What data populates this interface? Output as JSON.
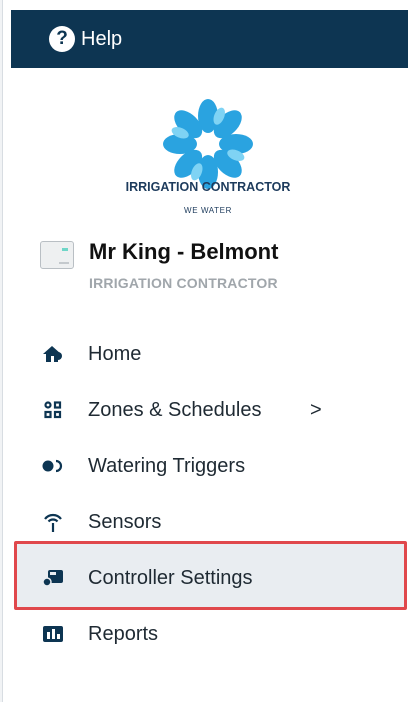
{
  "header": {
    "help_label": "Help",
    "help_icon": "question-circle-icon"
  },
  "logo": {
    "brand": "IRRIGATION CONTRACTOR",
    "tagline": "WE WATER",
    "colors": [
      "#2aa3e0",
      "#5bc5f0",
      "#1a7fc0"
    ]
  },
  "controller": {
    "name": "Mr King - Belmont",
    "subtitle": "IRRIGATION CONTRACTOR"
  },
  "nav": {
    "items": [
      {
        "label": "Home",
        "icon": "home-icon"
      },
      {
        "label": "Zones & Schedules",
        "icon": "zones-grid-icon",
        "chevron": ">"
      },
      {
        "label": "Watering Triggers",
        "icon": "trigger-icon"
      },
      {
        "label": "Sensors",
        "icon": "antenna-icon"
      },
      {
        "label": "Controller Settings",
        "icon": "controller-settings-icon",
        "active": true
      },
      {
        "label": "Reports",
        "icon": "reports-icon"
      }
    ]
  },
  "colors": {
    "header_bg": "#0d3552",
    "highlight": "#e0484c",
    "active_bg": "#e9edf1"
  }
}
